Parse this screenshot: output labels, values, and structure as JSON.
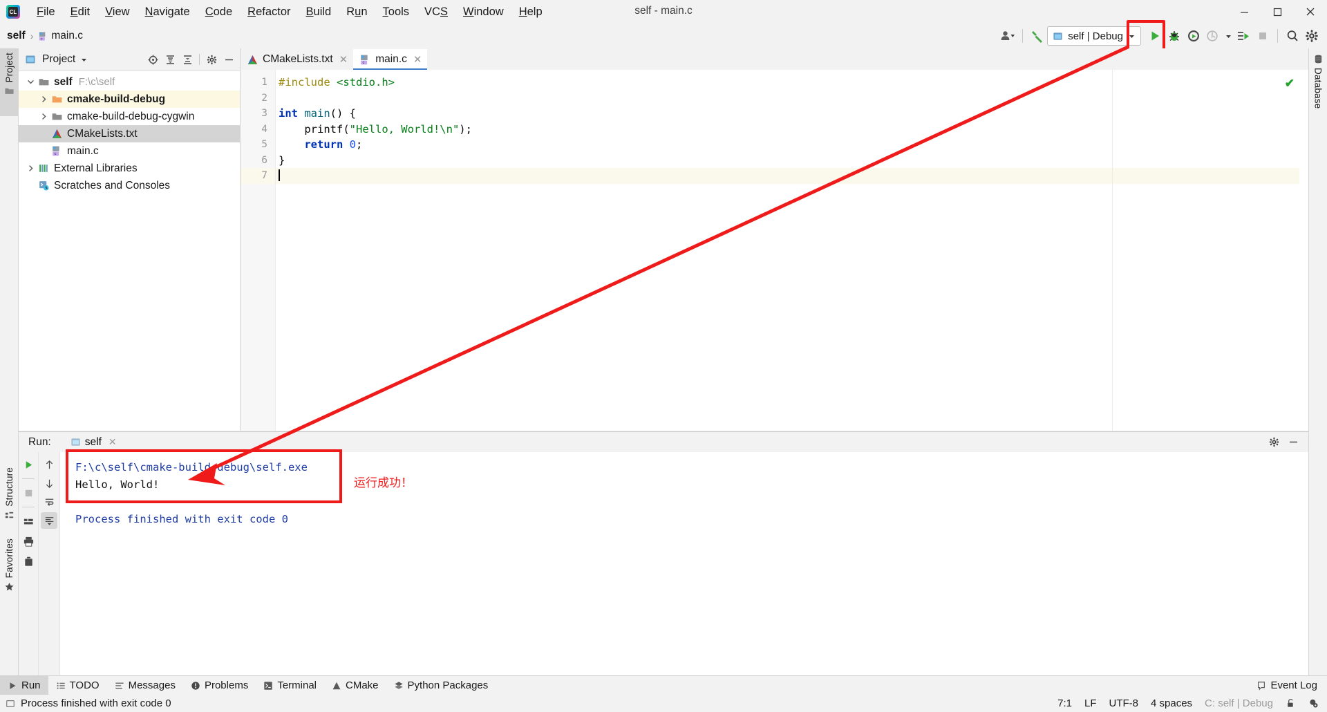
{
  "window": {
    "title": "self - main.c",
    "controls": {
      "minimize": "minimize-icon",
      "maximize": "maximize-icon",
      "close": "close-icon"
    }
  },
  "menu": {
    "items": [
      {
        "label": "File",
        "mnemonic": "F"
      },
      {
        "label": "Edit",
        "mnemonic": "E"
      },
      {
        "label": "View",
        "mnemonic": "V"
      },
      {
        "label": "Navigate",
        "mnemonic": "N"
      },
      {
        "label": "Code",
        "mnemonic": "C"
      },
      {
        "label": "Refactor",
        "mnemonic": "R"
      },
      {
        "label": "Build",
        "mnemonic": "B"
      },
      {
        "label": "Run",
        "mnemonic": "u"
      },
      {
        "label": "Tools",
        "mnemonic": "T"
      },
      {
        "label": "VCS",
        "mnemonic": "S"
      },
      {
        "label": "Window",
        "mnemonic": "W"
      },
      {
        "label": "Help",
        "mnemonic": "H"
      }
    ]
  },
  "breadcrumb": {
    "root": "self",
    "separator": "›",
    "leaf": "main.c"
  },
  "toolbar": {
    "run_config": "self | Debug",
    "buttons": [
      {
        "name": "account-icon",
        "tooltip": "Account"
      },
      {
        "name": "build-hammer-icon",
        "tooltip": "Build"
      },
      {
        "name": "run-icon",
        "tooltip": "Run"
      },
      {
        "name": "debug-icon",
        "tooltip": "Debug"
      },
      {
        "name": "coverage-icon",
        "tooltip": "Run with Coverage"
      },
      {
        "name": "profiler-icon",
        "tooltip": "Profile"
      },
      {
        "name": "attach-icon",
        "tooltip": "Attach to Process"
      },
      {
        "name": "stop-icon",
        "tooltip": "Stop"
      },
      {
        "name": "search-icon",
        "tooltip": "Search Everywhere"
      },
      {
        "name": "settings-icon",
        "tooltip": "Settings"
      }
    ]
  },
  "left_tool_tabs": [
    "Project",
    "Structure",
    "Favorites"
  ],
  "right_tool_tabs": [
    "Database"
  ],
  "project_panel": {
    "title": "Project",
    "header_icons": [
      "locate-icon",
      "expand-all-icon",
      "collapse-all-icon",
      "gear-icon",
      "hide-icon"
    ],
    "tree": [
      {
        "label": "self",
        "path": "F:\\c\\self",
        "icon": "folder-icon",
        "arrow": "expanded",
        "indent": 0,
        "state": "normal"
      },
      {
        "label": "cmake-build-debug",
        "path": "",
        "icon": "folder-orange-icon",
        "arrow": "collapsed",
        "indent": 1,
        "state": "highlight"
      },
      {
        "label": "cmake-build-debug-cygwin",
        "path": "",
        "icon": "folder-icon",
        "arrow": "collapsed",
        "indent": 1,
        "state": "normal"
      },
      {
        "label": "CMakeLists.txt",
        "path": "",
        "icon": "cmake-icon",
        "arrow": "none",
        "indent": 1,
        "state": "selected"
      },
      {
        "label": "main.c",
        "path": "",
        "icon": "c-file-icon",
        "arrow": "none",
        "indent": 1,
        "state": "normal"
      },
      {
        "label": "External Libraries",
        "path": "",
        "icon": "libraries-icon",
        "arrow": "collapsed",
        "indent": 0,
        "state": "normal"
      },
      {
        "label": "Scratches and Consoles",
        "path": "",
        "icon": "scratches-icon",
        "arrow": "none",
        "indent": 0,
        "state": "normal"
      }
    ]
  },
  "editor": {
    "tabs": [
      {
        "label": "CMakeLists.txt",
        "icon": "cmake-icon",
        "active": false,
        "close": "✕"
      },
      {
        "label": "main.c",
        "icon": "c-file-icon",
        "active": true,
        "close": "✕"
      }
    ],
    "inspection_status": "✔",
    "line_numbers": [
      "1",
      "2",
      "3",
      "4",
      "5",
      "6",
      "7"
    ],
    "current_line": 7,
    "code": [
      {
        "n": 1,
        "tokens": [
          {
            "t": "#include ",
            "c": "pp"
          },
          {
            "t": "<stdio.h>",
            "c": "inc"
          }
        ]
      },
      {
        "n": 2,
        "tokens": []
      },
      {
        "n": 3,
        "tokens": [
          {
            "t": "int ",
            "c": "k"
          },
          {
            "t": "main",
            "c": "fn"
          },
          {
            "t": "() {",
            "c": "pl"
          }
        ]
      },
      {
        "n": 4,
        "tokens": [
          {
            "t": "    printf(",
            "c": "pl"
          },
          {
            "t": "\"Hello, World!\\n\"",
            "c": "str"
          },
          {
            "t": ");",
            "c": "pl"
          }
        ]
      },
      {
        "n": 5,
        "tokens": [
          {
            "t": "    ",
            "c": "pl"
          },
          {
            "t": "return ",
            "c": "k"
          },
          {
            "t": "0",
            "c": "num"
          },
          {
            "t": ";",
            "c": "pl"
          }
        ]
      },
      {
        "n": 6,
        "tokens": [
          {
            "t": "}",
            "c": "pl"
          }
        ]
      },
      {
        "n": 7,
        "tokens": []
      }
    ]
  },
  "run_panel": {
    "label": "Run:",
    "tab": "self",
    "tab_close": "✕",
    "gutter_buttons": [
      "rerun-icon",
      "stop-icon",
      "layout-icon",
      "print-icon",
      "trash-icon"
    ],
    "gutter2_buttons": [
      "up-arrow-icon",
      "down-arrow-icon",
      "soft-wrap-icon",
      "scroll-end-icon"
    ],
    "header_buttons": [
      "settings-icon",
      "hide-icon"
    ],
    "console": [
      {
        "text": "F:\\c\\self\\cmake-build-debug\\self.exe",
        "color": "blue"
      },
      {
        "text": "Hello, World!",
        "color": "black"
      },
      {
        "text": "",
        "color": "blue"
      },
      {
        "text": "Process finished with exit code 0",
        "color": "blue"
      }
    ]
  },
  "annotations": {
    "highlight_color": "#ef1b1b",
    "note_text": "运行成功！"
  },
  "bottom_bar": {
    "items": [
      {
        "label": "Run",
        "icon": "run-icon",
        "active": true
      },
      {
        "label": "TODO",
        "icon": "todo-icon",
        "active": false
      },
      {
        "label": "Messages",
        "icon": "messages-icon",
        "active": false
      },
      {
        "label": "Problems",
        "icon": "problems-icon",
        "active": false
      },
      {
        "label": "Terminal",
        "icon": "terminal-icon",
        "active": false
      },
      {
        "label": "CMake",
        "icon": "cmake-icon",
        "active": false
      },
      {
        "label": "Python Packages",
        "icon": "python-icon",
        "active": false
      }
    ],
    "event_log": "Event Log"
  },
  "status_bar": {
    "message": "Process finished with exit code 0",
    "caret_position": "7:1",
    "line_separator": "LF",
    "encoding": "UTF-8",
    "indent": "4 spaces",
    "config": "C: self | Debug",
    "icons": [
      "lock-icon",
      "inspection-settings-icon"
    ]
  }
}
